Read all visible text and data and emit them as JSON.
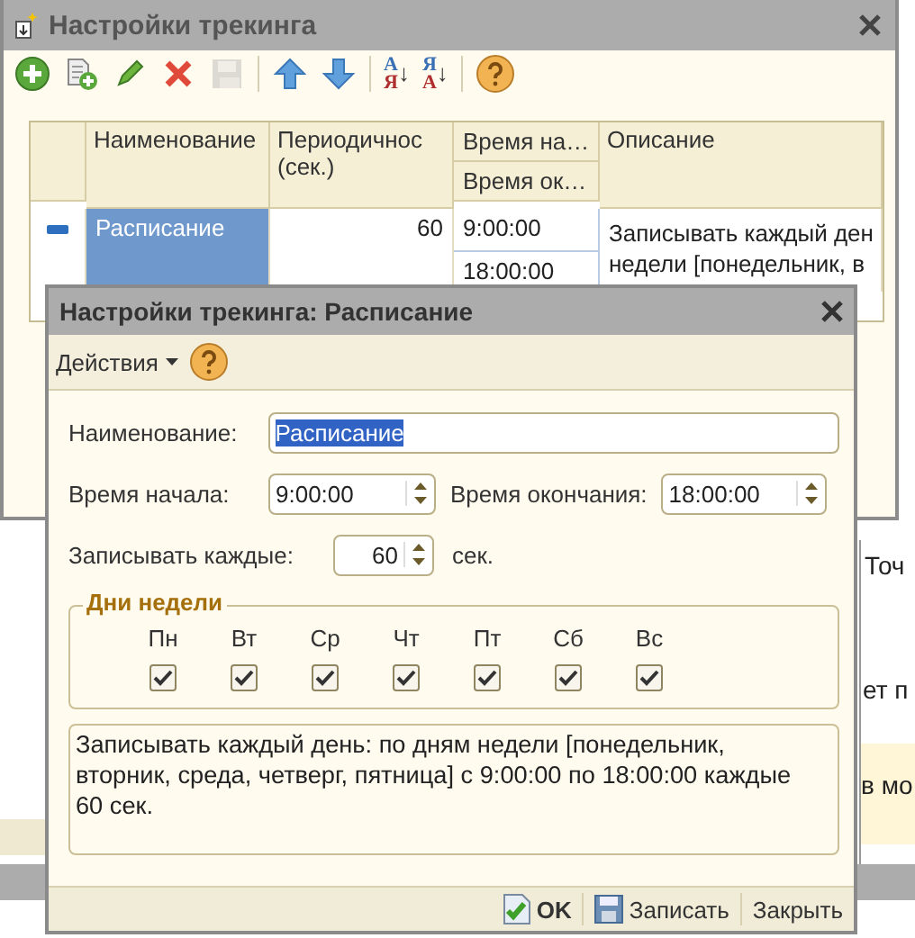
{
  "main_window": {
    "title": "Настройки трекинга",
    "toolbar": [
      {
        "kind": "add"
      },
      {
        "kind": "copy"
      },
      {
        "kind": "edit"
      },
      {
        "kind": "delete"
      },
      {
        "kind": "save",
        "disabled": true
      },
      {
        "kind": "up"
      },
      {
        "kind": "down"
      },
      {
        "kind": "sort",
        "top": "А",
        "bottom": "Я",
        "arrow": "↓"
      },
      {
        "kind": "sort",
        "top": "Я",
        "bottom": "А",
        "arrow": "↓"
      },
      {
        "kind": "help"
      }
    ],
    "table": {
      "columns": [
        {
          "label": "Наименование"
        },
        {
          "label": "Периодичнос (сек.)"
        },
        {
          "label": "Время на…",
          "sub_label": "Время ок…"
        },
        {
          "label": "Описание"
        }
      ],
      "rows": [
        {
          "name": "Расписание",
          "selected": true,
          "period": "60",
          "start": "9:00:00",
          "end": "18:00:00",
          "description_lines": [
            "Записывать каждый ден",
            "недели [понедельник, в"
          ]
        }
      ]
    }
  },
  "background_fragments": [
    "Точ",
    "ет п",
    "в мо"
  ],
  "dialog": {
    "title": "Настройки трекинга: Расписание",
    "actions_menu": "Действия",
    "name_label": "Наименование:",
    "name_value": "Расписание",
    "name_selected": true,
    "start_label": "Время начала:",
    "start_value": "9:00:00",
    "end_label": "Время окончания:",
    "end_value": "18:00:00",
    "period_label": "Записывать каждые:",
    "period_value": "60",
    "period_unit": "сек.",
    "days_group": "Дни недели",
    "days": [
      {
        "label": "Пн",
        "checked": true
      },
      {
        "label": "Вт",
        "checked": true
      },
      {
        "label": "Ср",
        "checked": true
      },
      {
        "label": "Чт",
        "checked": true
      },
      {
        "label": "Пт",
        "checked": true
      },
      {
        "label": "Сб",
        "checked": true
      },
      {
        "label": "Вс",
        "checked": true
      }
    ],
    "summary": "Записывать каждый день: по дням недели [понедельник, вторник, среда, четверг, пятница] с 9:00:00 по 18:00:00 каждые 60 сек.",
    "buttons": [
      {
        "label": "OK",
        "kind": "ok"
      },
      {
        "label": "Записать",
        "kind": "save"
      },
      {
        "label": "Закрыть",
        "kind": "close"
      }
    ]
  }
}
